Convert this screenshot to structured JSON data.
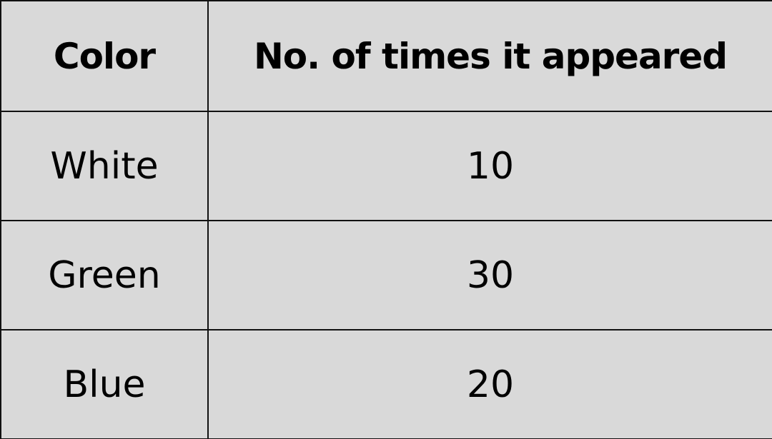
{
  "table": {
    "headers": {
      "color": "Color",
      "count": "No. of times it appeared"
    },
    "rows": [
      {
        "color": "White",
        "count": "10"
      },
      {
        "color": "Green",
        "count": "30"
      },
      {
        "color": "Blue",
        "count": "20"
      }
    ]
  },
  "chart_data": {
    "type": "table",
    "columns": [
      "Color",
      "No. of times it appeared"
    ],
    "rows": [
      [
        "White",
        10
      ],
      [
        "Green",
        30
      ],
      [
        "Blue",
        20
      ]
    ]
  }
}
